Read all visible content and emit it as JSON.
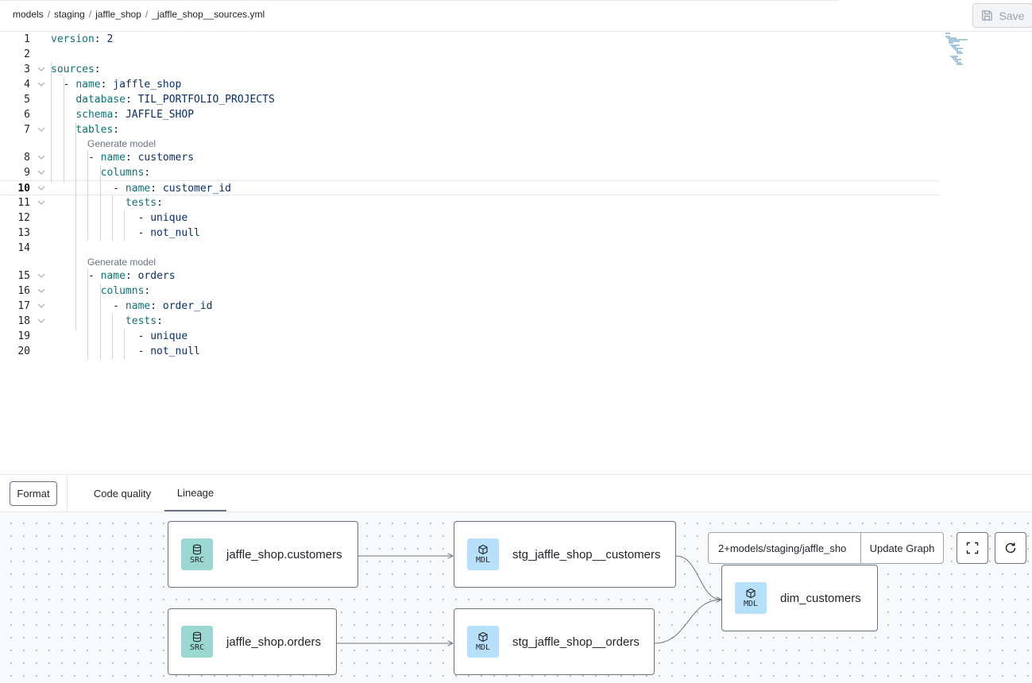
{
  "breadcrumb": [
    "models",
    "staging",
    "jaffle_shop",
    "_jaffle_shop__sources.yml"
  ],
  "toolbar": {
    "save_label": "Save"
  },
  "editor": {
    "active_line": 10,
    "codelens_label": "Generate model",
    "lines": [
      {
        "n": "1",
        "tokens": [
          [
            "k",
            "version"
          ],
          [
            "p",
            ": "
          ],
          [
            "v",
            "2"
          ]
        ]
      },
      {
        "n": "2",
        "tokens": []
      },
      {
        "n": "3",
        "tokens": [
          [
            "k",
            "sources"
          ],
          [
            "p",
            ":"
          ]
        ]
      },
      {
        "n": "4",
        "tokens": [
          [
            "p",
            "  - "
          ],
          [
            "k",
            "name"
          ],
          [
            "p",
            ": "
          ],
          [
            "v",
            "jaffle_shop"
          ]
        ]
      },
      {
        "n": "5",
        "tokens": [
          [
            "p",
            "    "
          ],
          [
            "k",
            "database"
          ],
          [
            "p",
            ": "
          ],
          [
            "v",
            "TIL_PORTFOLIO_PROJECTS"
          ]
        ]
      },
      {
        "n": "6",
        "tokens": [
          [
            "p",
            "    "
          ],
          [
            "k",
            "schema"
          ],
          [
            "p",
            ": "
          ],
          [
            "v",
            "JAFFLE_SHOP"
          ]
        ]
      },
      {
        "n": "7",
        "tokens": [
          [
            "p",
            "    "
          ],
          [
            "k",
            "tables"
          ],
          [
            "p",
            ":"
          ]
        ]
      },
      {
        "n": "8",
        "tokens": [
          [
            "p",
            "      - "
          ],
          [
            "k",
            "name"
          ],
          [
            "p",
            ": "
          ],
          [
            "v",
            "customers"
          ]
        ]
      },
      {
        "n": "9",
        "tokens": [
          [
            "p",
            "        "
          ],
          [
            "k",
            "columns"
          ],
          [
            "p",
            ":"
          ]
        ]
      },
      {
        "n": "10",
        "tokens": [
          [
            "p",
            "          - "
          ],
          [
            "k",
            "name"
          ],
          [
            "p",
            ": "
          ],
          [
            "v",
            "customer_id"
          ]
        ]
      },
      {
        "n": "11",
        "tokens": [
          [
            "p",
            "            "
          ],
          [
            "k",
            "tests"
          ],
          [
            "p",
            ":"
          ]
        ]
      },
      {
        "n": "12",
        "tokens": [
          [
            "p",
            "              - "
          ],
          [
            "v",
            "unique"
          ]
        ]
      },
      {
        "n": "13",
        "tokens": [
          [
            "p",
            "              - "
          ],
          [
            "v",
            "not_null"
          ]
        ]
      },
      {
        "n": "14",
        "tokens": []
      },
      {
        "n": "15",
        "tokens": [
          [
            "p",
            "      - "
          ],
          [
            "k",
            "name"
          ],
          [
            "p",
            ": "
          ],
          [
            "v",
            "orders"
          ]
        ]
      },
      {
        "n": "16",
        "tokens": [
          [
            "p",
            "        "
          ],
          [
            "k",
            "columns"
          ],
          [
            "p",
            ":"
          ]
        ]
      },
      {
        "n": "17",
        "tokens": [
          [
            "p",
            "          - "
          ],
          [
            "k",
            "name"
          ],
          [
            "p",
            ": "
          ],
          [
            "v",
            "order_id"
          ]
        ]
      },
      {
        "n": "18",
        "tokens": [
          [
            "p",
            "            "
          ],
          [
            "k",
            "tests"
          ],
          [
            "p",
            ":"
          ]
        ]
      },
      {
        "n": "19",
        "tokens": [
          [
            "p",
            "              - "
          ],
          [
            "v",
            "unique"
          ]
        ]
      },
      {
        "n": "20",
        "tokens": [
          [
            "p",
            "              - "
          ],
          [
            "v",
            "not_null"
          ]
        ]
      }
    ]
  },
  "panel": {
    "format_label": "Format",
    "tabs": [
      {
        "label": "Code quality"
      },
      {
        "label": "Lineage"
      }
    ]
  },
  "lineage": {
    "selector_value": "2+models/staging/jaffle_sho",
    "update_label": "Update Graph",
    "nodes": [
      {
        "badge": "SRC",
        "label": "jaffle_shop.customers"
      },
      {
        "badge": "SRC",
        "label": "jaffle_shop.orders"
      },
      {
        "badge": "MDL",
        "label": "stg_jaffle_shop__customers"
      },
      {
        "badge": "MDL",
        "label": "stg_jaffle_shop__orders"
      },
      {
        "badge": "MDL",
        "label": "dim_customers"
      }
    ]
  },
  "colors": {
    "key": "#0d7377",
    "value": "#0a3069",
    "src_badge": "#9bd8d1",
    "mdl_badge": "#b7e1fb"
  }
}
